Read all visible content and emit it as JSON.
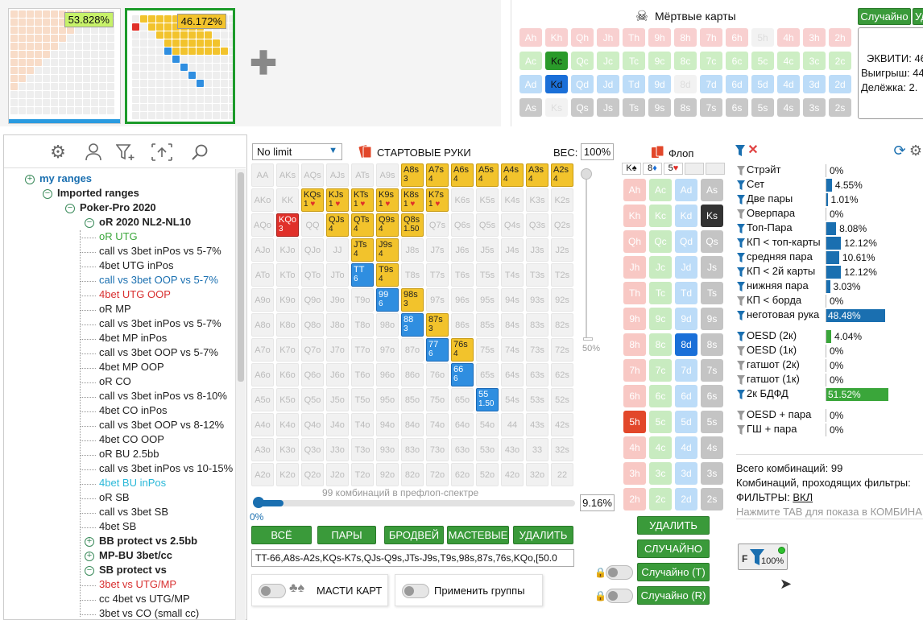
{
  "thumbs": [
    {
      "pct": "53.828%"
    },
    {
      "pct": "46.172%"
    }
  ],
  "dead": {
    "title": "Мёртвые карты",
    "random_label": "Случайно",
    "del_label": "Уд",
    "rows": [
      {
        "cards": [
          "Ah",
          "Kh",
          "Qh",
          "Jh",
          "Th",
          "9h",
          "8h",
          "7h",
          "6h",
          "5h",
          "4h",
          "3h",
          "2h"
        ],
        "cls": "h"
      },
      {
        "cards": [
          "Ac",
          "Kc",
          "Qc",
          "Jc",
          "Tc",
          "9c",
          "8c",
          "7c",
          "6c",
          "5c",
          "4c",
          "3c",
          "2c"
        ],
        "cls": "c"
      },
      {
        "cards": [
          "Ad",
          "Kd",
          "Qd",
          "Jd",
          "Td",
          "9d",
          "8d",
          "7d",
          "6d",
          "5d",
          "4d",
          "3d",
          "2d"
        ],
        "cls": "d"
      },
      {
        "cards": [
          "As",
          "Ks",
          "Qs",
          "Js",
          "Ts",
          "9s",
          "8s",
          "7s",
          "6s",
          "5s",
          "4s",
          "3s",
          "2s"
        ],
        "cls": "s"
      }
    ],
    "equity": "ЭКВИТИ: 46",
    "win": "Выигрыш: 44",
    "split": "Делёжка: 2."
  },
  "tree": [
    {
      "t": "my ranges",
      "lvl": 0,
      "c": "#1a6fb0",
      "b": true,
      "pm": "+"
    },
    {
      "t": "Imported ranges",
      "lvl": 1,
      "c": "#222",
      "b": true,
      "pm": "−"
    },
    {
      "t": "Poker-Pro 2020",
      "lvl": 2,
      "c": "#222",
      "b": true,
      "pm": "−"
    },
    {
      "t": "oR 2020 NL2-NL10",
      "lvl": 3,
      "c": "#222",
      "b": true,
      "pm": "−"
    },
    {
      "t": "oR UTG",
      "lvl": 4,
      "c": "#3aa63a"
    },
    {
      "t": "call vs 3bet inPos vs 5-7%",
      "lvl": 4,
      "c": "#222"
    },
    {
      "t": "4bet UTG inPos",
      "lvl": 4,
      "c": "#222"
    },
    {
      "t": "call  vs 3bet OOP vs 5-7%",
      "lvl": 4,
      "c": "#1a6fb0"
    },
    {
      "t": "4bet UTG OOP",
      "lvl": 4,
      "c": "#d83030"
    },
    {
      "t": "oR MP",
      "lvl": 4,
      "c": "#222"
    },
    {
      "t": "call vs 3bet inPos vs 5-7%",
      "lvl": 4,
      "c": "#222"
    },
    {
      "t": "4bet MP inPos",
      "lvl": 4,
      "c": "#222"
    },
    {
      "t": "call vs 3bet OOP vs 5-7%",
      "lvl": 4,
      "c": "#222"
    },
    {
      "t": "4bet MP OOP",
      "lvl": 4,
      "c": "#222"
    },
    {
      "t": "oR CO",
      "lvl": 4,
      "c": "#222"
    },
    {
      "t": "call vs 3bet inPos vs 8-10%",
      "lvl": 4,
      "c": "#222"
    },
    {
      "t": "4bet CO inPos",
      "lvl": 4,
      "c": "#222"
    },
    {
      "t": "call vs 3bet OOP vs 8-12%",
      "lvl": 4,
      "c": "#222"
    },
    {
      "t": "4bet CO OOP",
      "lvl": 4,
      "c": "#222"
    },
    {
      "t": "oR BU 2.5bb",
      "lvl": 4,
      "c": "#222"
    },
    {
      "t": "call vs 3bet inPos vs 10-15%",
      "lvl": 4,
      "c": "#222"
    },
    {
      "t": "4bet BU inPos",
      "lvl": 4,
      "c": "#2ab8d8"
    },
    {
      "t": "oR SB",
      "lvl": 4,
      "c": "#222"
    },
    {
      "t": "call vs 3bet SB",
      "lvl": 4,
      "c": "#222"
    },
    {
      "t": "4bet SB",
      "lvl": 4,
      "c": "#222"
    },
    {
      "t": "BB protect vs 2.5bb",
      "lvl": 3,
      "c": "#222",
      "b": true,
      "pm": "+"
    },
    {
      "t": "MP-BU 3bet/cc",
      "lvl": 3,
      "c": "#222",
      "b": true,
      "pm": "+"
    },
    {
      "t": "SB protect vs",
      "lvl": 3,
      "c": "#222",
      "b": true,
      "pm": "−"
    },
    {
      "t": "3bet vs UTG/MP",
      "lvl": 4,
      "c": "#d83030"
    },
    {
      "t": "cc 4bet vs UTG/MP",
      "lvl": 4,
      "c": "#222"
    },
    {
      "t": "3bet vs CO (small cc)",
      "lvl": 4,
      "c": "#222"
    }
  ],
  "matrix": {
    "mode": "No limit",
    "title": "СТАРТОВЫЕ РУКИ",
    "weight_label": "ВЕС:",
    "weight": "100%",
    "slider_mark": "50%",
    "combos_caption": "99 комбинаций в префлоп-спектре",
    "progress_left": "0%",
    "progress_right": "9.16%",
    "progress": 0.0916,
    "ranks": [
      "A",
      "K",
      "Q",
      "J",
      "T",
      "9",
      "8",
      "7",
      "6",
      "5",
      "4",
      "3",
      "2"
    ],
    "selected": {
      "A8s": [
        "y",
        "3"
      ],
      "A7s": [
        "y",
        "4"
      ],
      "A6s": [
        "y",
        "4"
      ],
      "A5s": [
        "y",
        "4"
      ],
      "A4s": [
        "y",
        "4"
      ],
      "A3s": [
        "y",
        "4"
      ],
      "A2s": [
        "y",
        "4"
      ],
      "KQs": [
        "y",
        "1 ♥"
      ],
      "KJs": [
        "y",
        "1 ♥"
      ],
      "KTs": [
        "y",
        "1 ♥"
      ],
      "K9s": [
        "y",
        "1 ♥"
      ],
      "K8s": [
        "y",
        "1 ♥"
      ],
      "K7s": [
        "y",
        "1 ♥"
      ],
      "KQo": [
        "r",
        "3"
      ],
      "QJs": [
        "y",
        "4"
      ],
      "QTs": [
        "y",
        "4"
      ],
      "Q9s": [
        "y",
        "4"
      ],
      "Q8s": [
        "y",
        "1.50"
      ],
      "JTs": [
        "y",
        "4"
      ],
      "J9s": [
        "y",
        "4"
      ],
      "TT": [
        "b",
        "6"
      ],
      "T9s": [
        "y",
        "4"
      ],
      "99": [
        "b",
        "6"
      ],
      "98s": [
        "y",
        "3"
      ],
      "88": [
        "b",
        "3"
      ],
      "87s": [
        "y",
        "3"
      ],
      "77": [
        "b",
        "6"
      ],
      "76s": [
        "y",
        "4"
      ],
      "66": [
        "b",
        "6"
      ],
      "55": [
        "b",
        "1.50"
      ]
    },
    "buttons": [
      "ВСЁ",
      "ПАРЫ",
      "БРОДВЕЙ",
      "МАСТЕВЫЕ",
      "УДАЛИТЬ"
    ],
    "range_text": "TT-66,A8s-A2s,KQs-K7s,QJs-Q9s,JTs-J9s,T9s,98s,87s,76s,KQo,[50.0",
    "toggle1": "МАСТИ КАРТ",
    "toggle2": "Применить группы"
  },
  "flop": {
    "title": "Флоп",
    "slots": [
      "K♠",
      "8♦",
      "5♥",
      "",
      ""
    ],
    "rows": [
      [
        "Ah",
        "Ac",
        "Ad",
        "As"
      ],
      [
        "Kh",
        "Kc",
        "Kd",
        "Ks"
      ],
      [
        "Qh",
        "Qc",
        "Qd",
        "Qs"
      ],
      [
        "Jh",
        "Jc",
        "Jd",
        "Js"
      ],
      [
        "Th",
        "Tc",
        "Td",
        "Ts"
      ],
      [
        "9h",
        "9c",
        "9d",
        "9s"
      ],
      [
        "8h",
        "8c",
        "8d",
        "8s"
      ],
      [
        "7h",
        "7c",
        "7d",
        "7s"
      ],
      [
        "6h",
        "6c",
        "6d",
        "6s"
      ],
      [
        "5h",
        "5c",
        "5d",
        "5s"
      ],
      [
        "4h",
        "4c",
        "4d",
        "4s"
      ],
      [
        "3h",
        "3c",
        "3d",
        "3s"
      ],
      [
        "2h",
        "2c",
        "2d",
        "2s"
      ]
    ],
    "btn_delete": "УДАЛИТЬ",
    "btn_random": "СЛУЧАЙНО",
    "btn_random_t": "Случайно (T)",
    "btn_random_r": "Случайно (R)"
  },
  "filters": {
    "items": [
      {
        "l": "Стрэйт",
        "v": "0%",
        "f": 0,
        "c": "#1a6fb0"
      },
      {
        "l": "Сет",
        "v": "4.55%",
        "f": 0.0455,
        "c": "#1a6fb0"
      },
      {
        "l": "Две пары",
        "v": "1.01%",
        "f": 0.0101,
        "c": "#1a6fb0"
      },
      {
        "l": "Оверпара",
        "v": "0%",
        "f": 0,
        "c": "#1a6fb0"
      },
      {
        "l": "Топ-Пара",
        "v": "8.08%",
        "f": 0.0808,
        "c": "#1a6fb0"
      },
      {
        "l": "КП < топ-карты",
        "v": "12.12%",
        "f": 0.1212,
        "c": "#1a6fb0"
      },
      {
        "l": "средняя пара",
        "v": "10.61%",
        "f": 0.1061,
        "c": "#1a6fb0"
      },
      {
        "l": "КП < 2й карты",
        "v": "12.12%",
        "f": 0.1212,
        "c": "#1a6fb0"
      },
      {
        "l": "нижняя пара",
        "v": "3.03%",
        "f": 0.0303,
        "c": "#1a6fb0"
      },
      {
        "l": "КП < борда",
        "v": "0%",
        "f": 0,
        "c": "#1a6fb0"
      },
      {
        "l": "неготовая рука",
        "v": "48.48%",
        "f": 0.4848,
        "c": "#1a6fb0"
      },
      {
        "l": "OESD (2к)",
        "v": "4.04%",
        "f": 0.0404,
        "c": "#3aa63a"
      },
      {
        "l": "OESD (1к)",
        "v": "0%",
        "f": 0,
        "c": "#3aa63a"
      },
      {
        "l": "гатшот (2к)",
        "v": "0%",
        "f": 0,
        "c": "#3aa63a"
      },
      {
        "l": "гатшот (1к)",
        "v": "0%",
        "f": 0,
        "c": "#3aa63a"
      },
      {
        "l": "2к БДФД",
        "v": "51.52%",
        "f": 0.5152,
        "c": "#3aa63a"
      },
      {
        "l": "OESD + пара",
        "v": "0%",
        "f": 0,
        "c": "#3aa63a"
      },
      {
        "l": "ГШ + пара",
        "v": "0%",
        "f": 0,
        "c": "#3aa63a"
      }
    ],
    "total": "Всего комбинаций: 99",
    "passing": "Комбинаций, проходящих фильтры:",
    "filters_label": "ФИЛЬТРЫ: ",
    "filters_state": "ВКЛ",
    "hint": "Нажмите TAB для показа в КОМБИНА",
    "badge": "100%",
    "badge_letter": "F"
  }
}
